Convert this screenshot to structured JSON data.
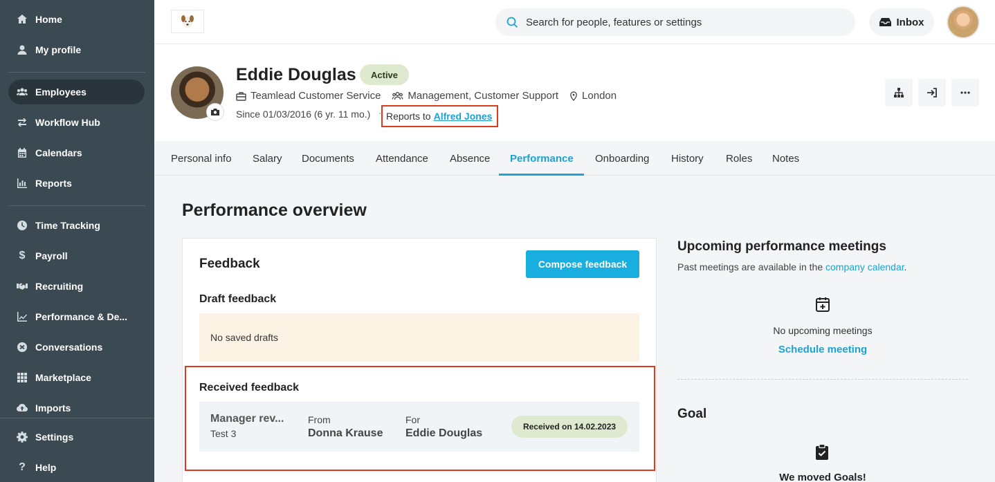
{
  "sidebar": {
    "items": [
      {
        "label": "Home",
        "icon": "home-icon"
      },
      {
        "label": "My profile",
        "icon": "user-icon"
      },
      {
        "label": "Employees",
        "icon": "people-icon",
        "active": true
      },
      {
        "label": "Workflow Hub",
        "icon": "workflow-icon"
      },
      {
        "label": "Calendars",
        "icon": "calendar-icon"
      },
      {
        "label": "Reports",
        "icon": "chart-icon"
      },
      {
        "label": "Time Tracking",
        "icon": "clock-icon"
      },
      {
        "label": "Payroll",
        "icon": "dollar-icon"
      },
      {
        "label": "Recruiting",
        "icon": "handshake-icon"
      },
      {
        "label": "Performance & De...",
        "icon": "trend-icon"
      },
      {
        "label": "Conversations",
        "icon": "conversation-icon"
      },
      {
        "label": "Marketplace",
        "icon": "grid-icon"
      },
      {
        "label": "Imports",
        "icon": "cloud-upload-icon"
      },
      {
        "label": "Settings",
        "icon": "gear-icon"
      },
      {
        "label": "Help",
        "icon": "question-icon"
      }
    ]
  },
  "topbar": {
    "search_placeholder": "Search for people, features or settings",
    "inbox_label": "Inbox"
  },
  "profile": {
    "name": "Eddie Douglas",
    "status": "Active",
    "position": "Teamlead Customer Service",
    "teams": "Management, Customer Support",
    "location": "London",
    "since": "Since 01/03/2016 (6 yr. 11 mo.)",
    "separator": "·",
    "reports_to_label": "Reports to",
    "reports_to_name": "Alfred Jones"
  },
  "tabs": [
    {
      "label": "Personal info"
    },
    {
      "label": "Salary"
    },
    {
      "label": "Documents"
    },
    {
      "label": "Attendance"
    },
    {
      "label": "Absence"
    },
    {
      "label": "Performance",
      "active": true
    },
    {
      "label": "Onboarding"
    },
    {
      "label": "History"
    },
    {
      "label": "Roles"
    },
    {
      "label": "Notes"
    }
  ],
  "main": {
    "title": "Performance overview",
    "feedback": {
      "title": "Feedback",
      "compose_label": "Compose feedback",
      "draft_title": "Draft feedback",
      "no_drafts": "No saved drafts",
      "received_title": "Received feedback",
      "item": {
        "type": "Manager rev...",
        "subtitle": "Test 3",
        "from_label": "From",
        "from_name": "Donna Krause",
        "for_label": "For",
        "for_name": "Eddie Douglas",
        "received": "Received on 14.02.2023"
      }
    },
    "meetings": {
      "title": "Upcoming performance meetings",
      "note_prefix": "Past meetings are available in the",
      "note_link": "company calendar",
      "note_suffix": ".",
      "empty": "No upcoming meetings",
      "schedule_label": "Schedule meeting"
    },
    "goal": {
      "title": "Goal",
      "moved": "We moved Goals!"
    }
  },
  "colors": {
    "accent": "#1aa3d4",
    "sidebar": "#3b4a52",
    "highlight": "#e03a1e",
    "status_badge": "#dfe9d0"
  }
}
